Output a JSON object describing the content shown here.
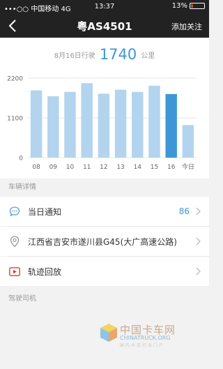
{
  "status_bar": {
    "carrier": "•••○○ 中国移动",
    "network": "4G",
    "time": "13:37",
    "battery": "13%"
  },
  "nav": {
    "title": "粤AS4501",
    "follow_label": "添加关注",
    "back_icon": "chevron-left-icon"
  },
  "summary": {
    "label": "8月16日行驶",
    "value": "1740",
    "unit": "公里"
  },
  "chart_data": {
    "type": "bar",
    "categories": [
      "08",
      "09",
      "10",
      "11",
      "12",
      "13",
      "14",
      "15",
      "16",
      "今日"
    ],
    "values": [
      1860,
      1700,
      1820,
      2060,
      1770,
      1880,
      1820,
      1990,
      1760,
      900
    ],
    "highlight_index": 8,
    "ylim": [
      0,
      2200
    ],
    "yticks": [
      0,
      1100,
      2200
    ],
    "colors": {
      "bar": "#b3d4ee",
      "highlight": "#3d97d6",
      "grid": "#e6e6e6",
      "tick": "#666666"
    }
  },
  "vehicle_section": {
    "header": "车辆详情",
    "rows": [
      {
        "label": "当日通知",
        "count": "86",
        "icon": "message-bubble-icon"
      },
      {
        "label": "江西省吉安市遂川县G45(大广高速公路)",
        "icon": "location-pin-icon"
      },
      {
        "label": "轨迹回放",
        "icon": "play-icon"
      }
    ]
  },
  "driver_section": {
    "header": "驾驶司机"
  },
  "watermark": {
    "cn": "中国卡车网",
    "en": "CHINATRUCK.ORG",
    "sub": "国内卡车行业门户"
  }
}
